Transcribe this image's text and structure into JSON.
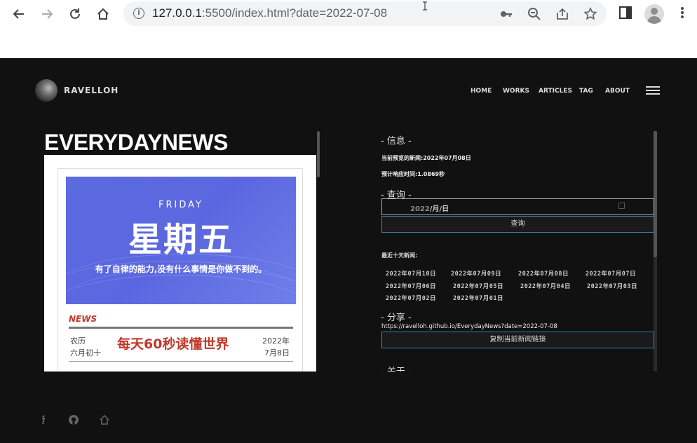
{
  "browser": {
    "url_host": "127.0.0.1",
    "url_rest": ":5500/index.html?date=2022-07-08"
  },
  "site": {
    "logo_text": "RAVELLOH",
    "nav": [
      "HOME",
      "WORKS",
      "ARTICLES",
      "TAG",
      "ABOUT"
    ],
    "heading": "EVERYDAYNEWS"
  },
  "card": {
    "day_en": "FRIDAY",
    "day_cn": "星期五",
    "quote": "有了自律的能力,没有什么事情是你做不到的。",
    "news_label": "NEWS",
    "lunar_label": "农历",
    "lunar_date": "六月初十",
    "title": "每天60秒读懂世界",
    "year": "2022年",
    "month_day": "7月8日"
  },
  "panel": {
    "info_heading": "- 信息 -",
    "preview_label": "当前预览的新闻:",
    "preview_value": "2022年07月08日",
    "response_label": "预计响应时间:",
    "response_value": "1.0869秒",
    "query_heading": "- 查询 -",
    "date_placeholder_year": "2022",
    "date_placeholder_rest": "/月/日",
    "query_button": "查询",
    "recent_label": "最近十天新闻:",
    "recent_dates": [
      "2022年07月10日",
      "2022年07月09日",
      "2022年07月08日",
      "2022年07月07日",
      "2022年07月06日",
      "2022年07月05日",
      "2022年07月04日",
      "2022年07月03日",
      "2022年07月02日",
      "2022年07月01日"
    ],
    "share_heading": "- 分享 -",
    "share_url": "https://ravelloh.github.io/EverydayNews?date=2022-07-08",
    "copy_button": "复制当前新闻链接",
    "about_heading": "- 关于 -"
  },
  "icons": {
    "back": "back-arrow-icon",
    "forward": "forward-arrow-icon",
    "reload": "reload-icon",
    "home": "home-icon",
    "key": "key-icon",
    "zoom": "zoom-out-icon",
    "share": "share-icon",
    "star": "star-icon",
    "sidepanel": "side-panel-icon",
    "menu": "kebab-menu-icon"
  }
}
